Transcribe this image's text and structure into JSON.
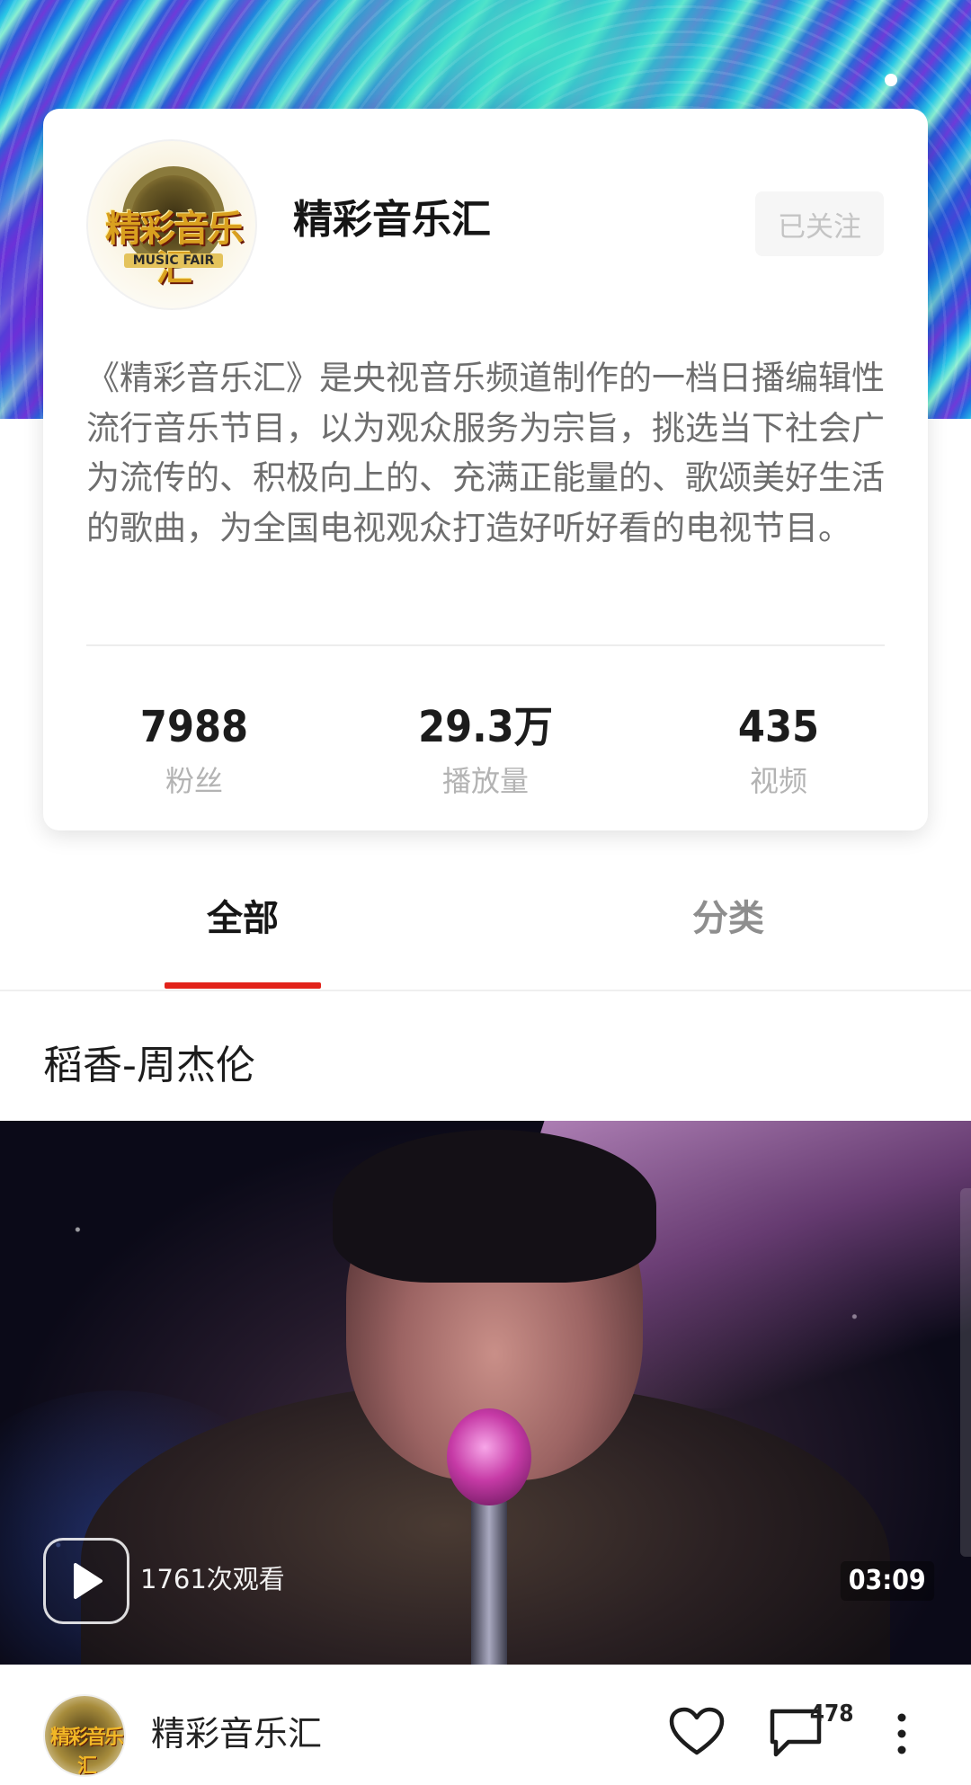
{
  "profile": {
    "avatar_text": "精彩音乐汇",
    "avatar_subtext": "MUSIC FAIR",
    "name": "精彩音乐汇",
    "follow_label": "已关注",
    "description": "《精彩音乐汇》是央视音乐频道制作的一档日播编辑性流行音乐节目，以为观众服务为宗旨，挑选当下社会广为流传的、积极向上的、充满正能量的、歌颂美好生活的歌曲，为全国电视观众打造好听好看的电视节目。",
    "stats": [
      {
        "value": "7988",
        "label": "粉丝"
      },
      {
        "value": "29.3万",
        "label": "播放量"
      },
      {
        "value": "435",
        "label": "视频"
      }
    ]
  },
  "tabs": [
    {
      "label": "全部",
      "active": true
    },
    {
      "label": "分类",
      "active": false
    }
  ],
  "video": {
    "title": "稻香-周杰伦",
    "views": "1761次观看",
    "duration": "03:09",
    "author": "精彩音乐汇",
    "comment_count": "478",
    "icons": [
      "play-icon",
      "heart-icon",
      "comment-icon",
      "more-vertical-icon"
    ]
  },
  "colors": {
    "accent_red": "#e2231a",
    "follow_bg": "#f6f6f6",
    "muted_text": "#b3b3b3"
  }
}
